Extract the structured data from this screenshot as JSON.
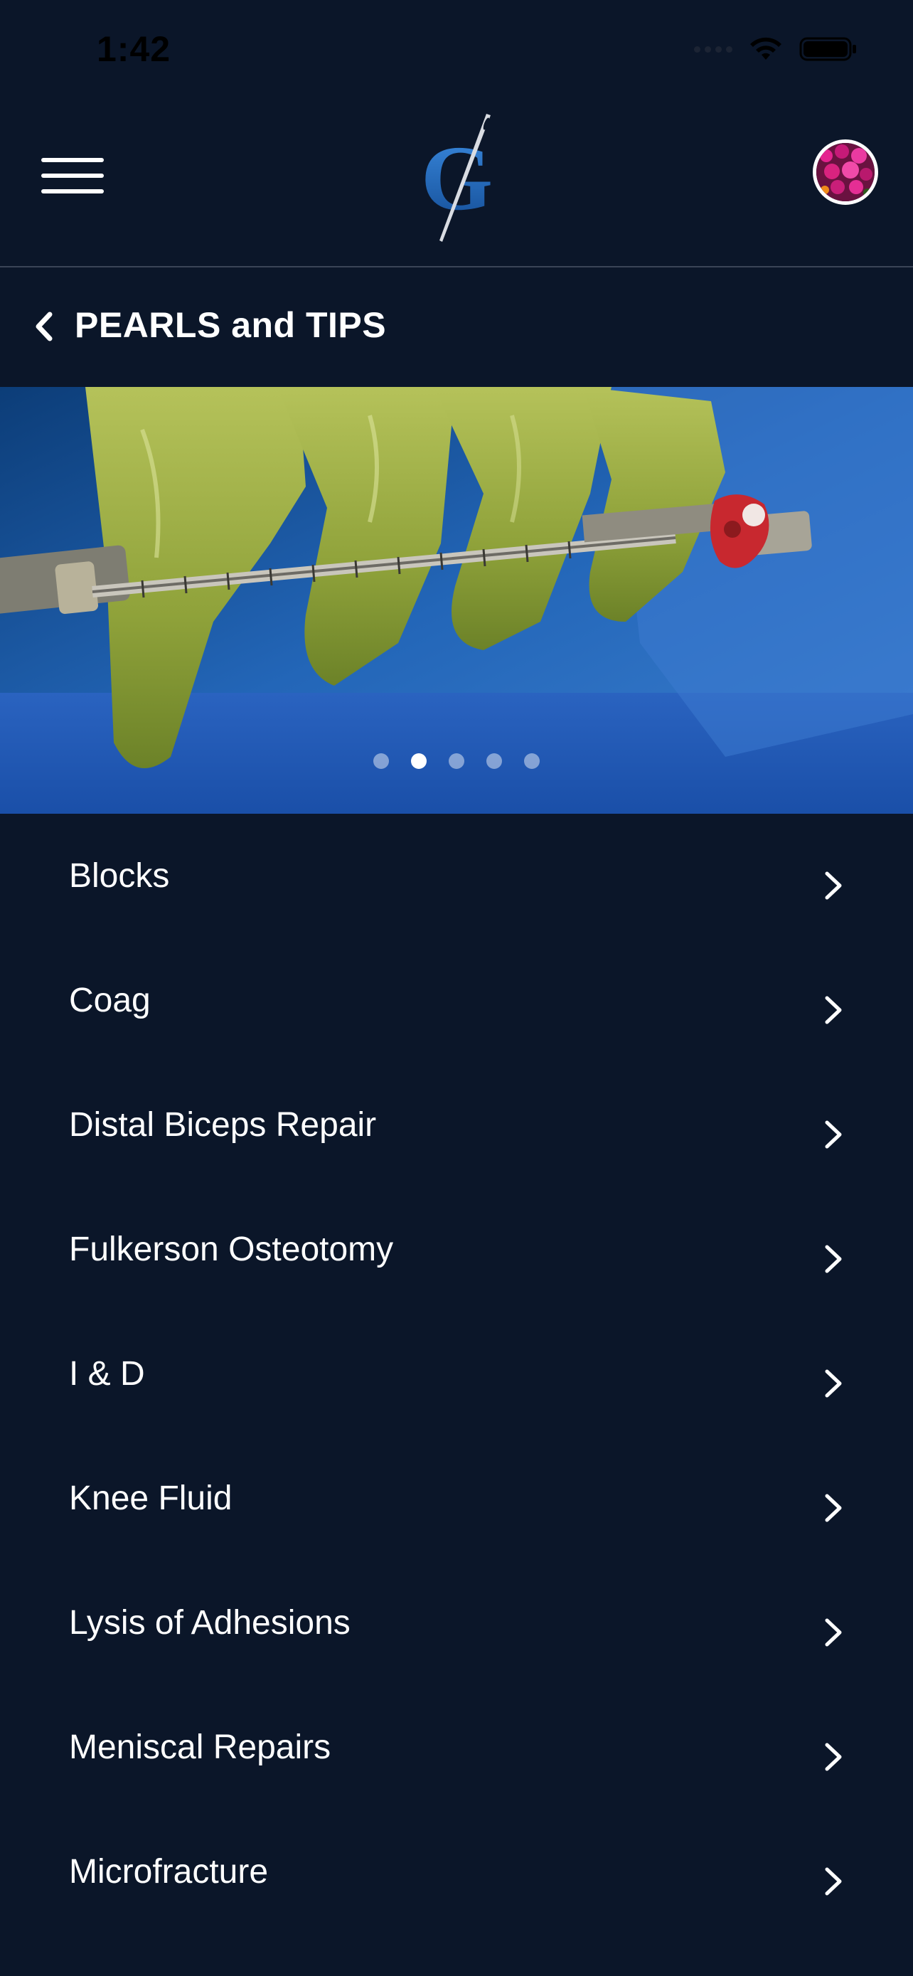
{
  "status_bar": {
    "time": "1:42",
    "icons": [
      "signal-icon",
      "wifi-icon",
      "battery-icon"
    ]
  },
  "header": {
    "menu_icon": "hamburger-menu-icon",
    "logo_letter": "G",
    "logo_icon": "needle-logo-icon",
    "avatar_icon": "user-avatar"
  },
  "title_bar": {
    "back_icon": "chevron-left-icon",
    "title": "PEARLS and TIPS"
  },
  "banner": {
    "slide_count": 5,
    "active_slide": 2
  },
  "topics": [
    {
      "label": "Blocks"
    },
    {
      "label": "Coag"
    },
    {
      "label": "Distal Biceps Repair"
    },
    {
      "label": "Fulkerson Osteotomy"
    },
    {
      "label": "I & D"
    },
    {
      "label": "Knee Fluid"
    },
    {
      "label": "Lysis of Adhesions"
    },
    {
      "label": "Meniscal Repairs"
    },
    {
      "label": "Microfracture"
    }
  ],
  "colors": {
    "background": "#0b1629",
    "text": "#ffffff",
    "divider": "#3a4456",
    "logo_blue": "#1f6ec9"
  }
}
